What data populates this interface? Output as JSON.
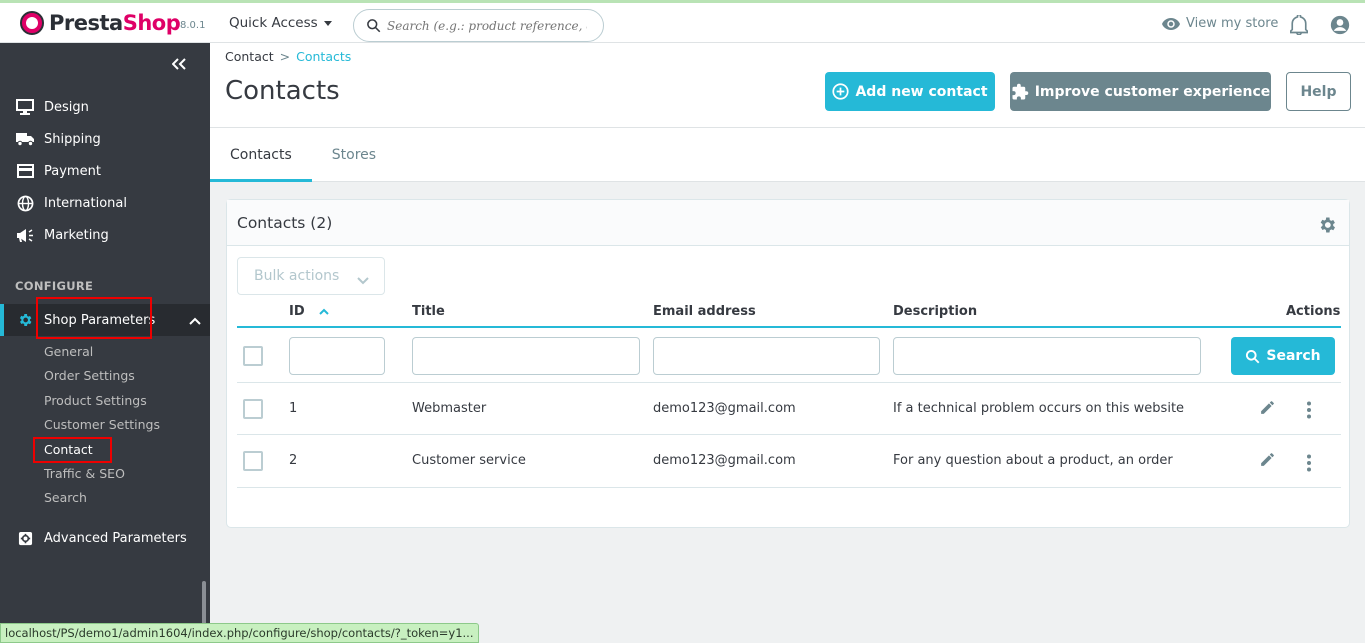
{
  "header": {
    "logo_part1": "Presta",
    "logo_part2": "Shop",
    "version": "8.0.1",
    "quick_access": "Quick Access",
    "search_placeholder": "Search (e.g.: product reference, custon",
    "view_store": "View my store"
  },
  "sidebar": {
    "items": [
      {
        "label": "Design",
        "icon": "monitor-icon"
      },
      {
        "label": "Shipping",
        "icon": "truck-icon"
      },
      {
        "label": "Payment",
        "icon": "credit-card-icon"
      },
      {
        "label": "International",
        "icon": "globe-icon"
      },
      {
        "label": "Marketing",
        "icon": "megaphone-icon"
      }
    ],
    "section_title": "CONFIGURE",
    "active_section": "Shop Parameters",
    "sub_items": [
      "General",
      "Order Settings",
      "Product Settings",
      "Customer Settings",
      "Contact",
      "Traffic & SEO",
      "Search"
    ],
    "active_sub": "Contact",
    "advanced": "Advanced Parameters"
  },
  "page": {
    "breadcrumb_root": "Contact",
    "breadcrumb_sep": ">",
    "breadcrumb_current": "Contacts",
    "title": "Contacts",
    "btn_add": "Add new contact",
    "btn_improve": "Improve customer experience",
    "btn_help": "Help",
    "tabs": [
      "Contacts",
      "Stores"
    ]
  },
  "grid": {
    "title": "Contacts (2)",
    "bulk_actions": "Bulk actions",
    "columns": {
      "id": "ID",
      "title": "Title",
      "email": "Email address",
      "description": "Description",
      "actions": "Actions"
    },
    "search_button": "Search",
    "rows": [
      {
        "id": "1",
        "title": "Webmaster",
        "email": "demo123@gmail.com",
        "description": "If a technical problem occurs on this website"
      },
      {
        "id": "2",
        "title": "Customer service",
        "email": "demo123@gmail.com",
        "description": "For any question about a product, an order"
      }
    ]
  },
  "statusbar": "localhost/PS/demo1/admin1604/index.php/configure/shop/contacts/?_token=y1...",
  "colors": {
    "accent": "#25b9d7",
    "sidebar": "#363a41",
    "highlight": "#e00000"
  }
}
